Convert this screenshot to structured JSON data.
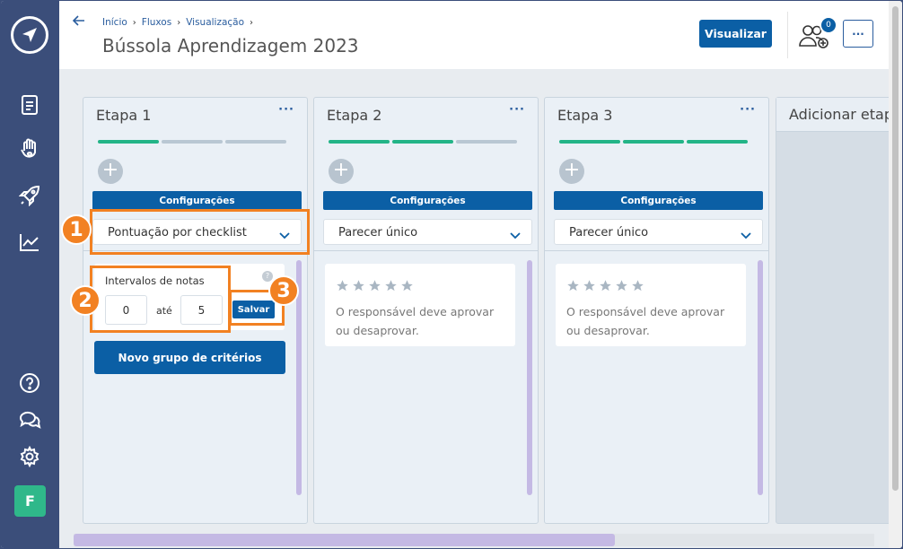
{
  "header": {
    "breadcrumb": [
      "Início",
      "Fluxos",
      "Visualização"
    ],
    "title": "Bússola Aprendizagem 2023",
    "visualize_label": "Visualizar",
    "participants_count": "0",
    "more_label": "···"
  },
  "sidebar": {
    "icons": [
      "document-icon",
      "hand-heart-icon",
      "rocket-icon",
      "chart-icon",
      "help-icon",
      "chat-icon",
      "gear-icon"
    ],
    "avatar_letter": "F"
  },
  "columns": [
    {
      "title": "Etapa 1",
      "menu": "···",
      "progress": [
        true,
        false,
        false
      ],
      "config_label": "Configurações",
      "select_value": "Pontuação por checklist",
      "interval_label": "Intervalos de notas",
      "min_value": "0",
      "between_label": "até",
      "max_value": "5",
      "save_label": "Salvar",
      "new_group_label": "Novo grupo de critérios"
    },
    {
      "title": "Etapa 2",
      "menu": "···",
      "progress": [
        true,
        true,
        false
      ],
      "config_label": "Configurações",
      "select_value": "Parecer único",
      "card_text": "O responsável deve aprovar ou desaprovar."
    },
    {
      "title": "Etapa 3",
      "menu": "···",
      "progress": [
        true,
        true,
        true
      ],
      "config_label": "Configurações",
      "select_value": "Parecer único",
      "card_text": "O responsável deve aprovar ou desaprovar."
    }
  ],
  "add_column": {
    "label": "Adicionar etapa"
  },
  "annotations": [
    "1",
    "2",
    "3"
  ],
  "colors": {
    "sidebar": "#3b4e7a",
    "primary": "#0b5fa5",
    "accent": "#23b487",
    "annotation": "#f28122"
  }
}
